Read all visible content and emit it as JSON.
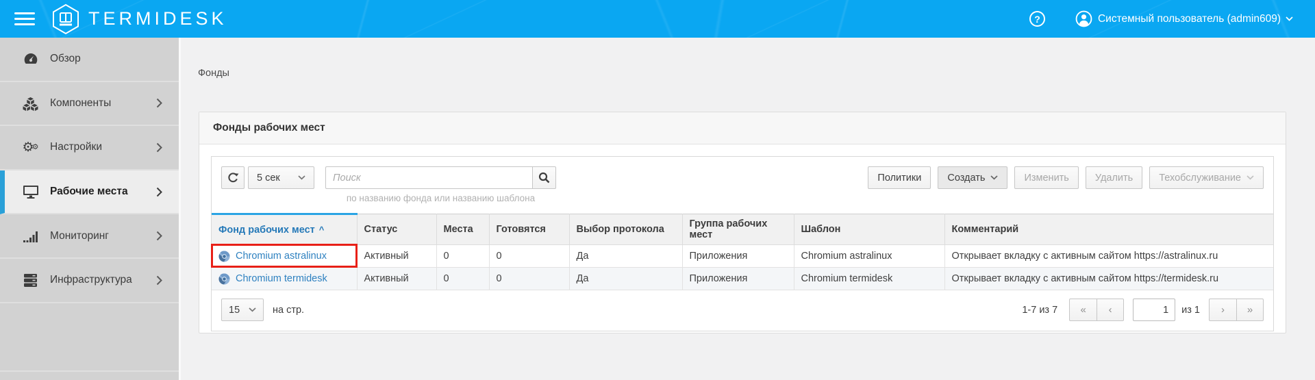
{
  "header": {
    "logo_text": "TERMIDESK",
    "help_label": "?",
    "user_name": "Системный пользователь (admin609)"
  },
  "sidebar": {
    "items": [
      {
        "label": "Обзор",
        "icon": "gauge-icon",
        "has_submenu": false,
        "active": false
      },
      {
        "label": "Компоненты",
        "icon": "cubes-icon",
        "has_submenu": true,
        "active": false
      },
      {
        "label": "Настройки",
        "icon": "gears-icon",
        "has_submenu": true,
        "active": false
      },
      {
        "label": "Рабочие места",
        "icon": "monitor-icon",
        "has_submenu": true,
        "active": true
      },
      {
        "label": "Мониторинг",
        "icon": "bar-chart-icon",
        "has_submenu": true,
        "active": false
      },
      {
        "label": "Инфраструктура",
        "icon": "server-icon",
        "has_submenu": true,
        "active": false
      }
    ]
  },
  "breadcrumb": "Фонды",
  "panel": {
    "title": "Фонды рабочих мест",
    "toolbar": {
      "interval_value": "5 сек",
      "search_placeholder": "Поиск",
      "search_hint": "по названию фонда или названию шаблона",
      "buttons": [
        {
          "label": "Политики",
          "enabled": true,
          "caret": false,
          "primary": false
        },
        {
          "label": "Создать",
          "enabled": true,
          "caret": true,
          "primary": true
        },
        {
          "label": "Изменить",
          "enabled": false,
          "caret": false,
          "primary": false
        },
        {
          "label": "Удалить",
          "enabled": false,
          "caret": false,
          "primary": false
        },
        {
          "label": "Техобслуживание",
          "enabled": false,
          "caret": true,
          "primary": false
        }
      ]
    },
    "table": {
      "columns": [
        "Фонд рабочих мест",
        "Статус",
        "Места",
        "Готовятся",
        "Выбор протокола",
        "Группа рабочих мест",
        "Шаблон",
        "Комментарий"
      ],
      "sort_column": "Фонд рабочих мест",
      "sort_indicator": "^",
      "rows": [
        {
          "name": "Chromium astralinux",
          "status": "Активный",
          "seats": "0",
          "preparing": "0",
          "protocol_choice": "Да",
          "group": "Приложения",
          "template": "Chromium astralinux",
          "comment": "Открывает вкладку с активным сайтом https://astralinux.ru",
          "highlighted": true
        },
        {
          "name": "Chromium termidesk",
          "status": "Активный",
          "seats": "0",
          "preparing": "0",
          "protocol_choice": "Да",
          "group": "Приложения",
          "template": "Chromium termidesk",
          "comment": "Открывает вкладку с активным сайтом https://termidesk.ru",
          "highlighted": false
        }
      ]
    },
    "pagination": {
      "page_size": "15",
      "page_size_label": "на стр.",
      "range_label": "1-7 из 7",
      "first_label": "«",
      "prev_label": "‹",
      "page_value": "1",
      "total_label": "из 1",
      "next_label": "›",
      "last_label": "»"
    }
  },
  "colors": {
    "header_blue": "#0aa7f2",
    "active_item_bar": "#2aa0d8",
    "link_blue": "#2e81c0",
    "sorted_header_blue": "#2579b8",
    "highlight_red": "#e82017"
  }
}
